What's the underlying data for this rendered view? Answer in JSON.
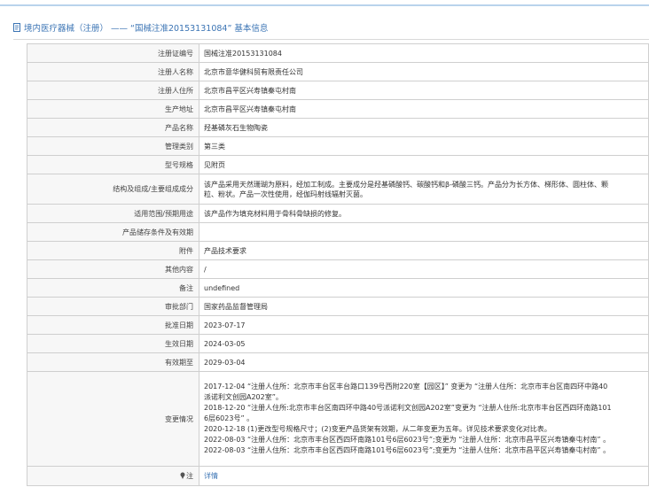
{
  "page": {
    "title_prefix": "境内医疗器械（注册） —— “国械注准20153131084” 基本信息"
  },
  "rows": [
    {
      "label": "注册证编号",
      "value": "国械注准20153131084"
    },
    {
      "label": "注册人名称",
      "value": "北京市意华健科贸有限责任公司"
    },
    {
      "label": "注册人住所",
      "value": "北京市昌平区兴寿镇秦屯村南"
    },
    {
      "label": "生产地址",
      "value": "北京市昌平区兴寿镇秦屯村南"
    },
    {
      "label": "产品名称",
      "value": "羟基磷灰石生物陶瓷"
    },
    {
      "label": "管理类别",
      "value": "第三类"
    },
    {
      "label": "型号规格",
      "value": "见附页"
    },
    {
      "label": "结构及组成/主要组成成分",
      "value_lines": [
        "该产品采用天然珊瑚为原料，经加工制成。主要成分是羟基磷酸钙、碳酸钙和β-磷酸三钙。产品分为长方体、梯形体、圆柱体、颗",
        "粒、粉状。产品一次性使用，经伽玛射线辐射灭菌。"
      ]
    },
    {
      "label": "适用范围/预期用途",
      "value": "该产品作为填充材料用于骨科骨缺损的修复。"
    },
    {
      "label": "产品储存条件及有效期",
      "value": ""
    },
    {
      "label": "附件",
      "value": "产品技术要求"
    },
    {
      "label": "其他内容",
      "value": "/"
    },
    {
      "label": "备注",
      "value": "undefined"
    },
    {
      "label": "审批部门",
      "value": "国家药品监督管理局"
    },
    {
      "label": "批准日期",
      "value": "2023-07-17"
    },
    {
      "label": "生效日期",
      "value": "2024-03-05"
    },
    {
      "label": "有效期至",
      "value": "2029-03-04"
    },
    {
      "label": "变更情况",
      "value_lines": [
        "2017-12-04 “注册人住所：北京市丰台区丰台路口139号西附220室【园区】” 变更为 “注册人住所：北京市丰台区南四环中路40",
        "派诺利文创园A202室”。",
        "2018-12-20 “注册人住所:北京市丰台区南四环中路40号派诺利文创园A202室”变更为 “注册人住所:北京市丰台区西四环南路101",
        "6层6023号” 。",
        "2020-12-18 (1)更改型号规格尺寸；(2)变更产品货架有效期，从二年变更为五年。详见技术要求变化对比表。",
        "2022-08-03 “注册人住所：北京市丰台区西四环南路101号6层6023号”;变更为 “注册人住所：北京市昌平区兴寿镇秦屯村南” 。",
        "2022-08-03 “注册人住所：北京市丰台区西四环南路101号6层6023号”;变更为 “注册人住所：北京市昌平区兴寿镇秦屯村南” 。"
      ]
    },
    {
      "label": "注",
      "value": "详情"
    }
  ],
  "colors": {
    "accent": "#3b74b4",
    "label_bg": "#f7f7f7",
    "border": "#cfcfcf"
  },
  "icons": {
    "title_icon": "document-icon",
    "note_icon": "pin-icon"
  }
}
